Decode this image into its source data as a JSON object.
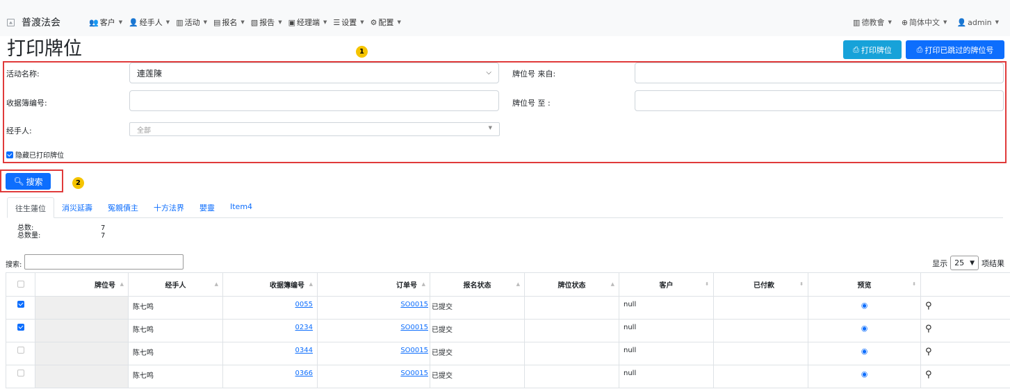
{
  "nav": {
    "brand": "普渡法会",
    "menu": [
      {
        "label": "客户",
        "icon": "users-icon"
      },
      {
        "label": "经手人",
        "icon": "user-icon"
      },
      {
        "label": "活动",
        "icon": "map-icon"
      },
      {
        "label": "报名",
        "icon": "clipboard-icon"
      },
      {
        "label": "报告",
        "icon": "file-icon"
      },
      {
        "label": "经理端",
        "icon": "briefcase-icon"
      },
      {
        "label": "设置",
        "icon": "sliders-icon"
      },
      {
        "label": "配置",
        "icon": "gear-icon"
      }
    ],
    "right": [
      {
        "label": "德教會",
        "icon": "building-icon"
      },
      {
        "label": "简体中文",
        "icon": "globe-icon"
      },
      {
        "label": "admin",
        "icon": "user-icon"
      }
    ]
  },
  "page": {
    "title": "打印牌位",
    "marker1": "1",
    "marker2": "2",
    "btn_print": "打印牌位",
    "btn_print_skipped": "打印已跳过的牌位号"
  },
  "filters": {
    "activity_label": "活动名称:",
    "activity_value": "連莲陳",
    "from_label": "牌位号 来自:",
    "from_value": "",
    "receipt_label": "收据簿编号:",
    "receipt_value": "",
    "to_label": "牌位号 至 :",
    "to_value": "",
    "handler_label": "经手人:",
    "handler_value": "全部",
    "hide_printed_label": "隐藏已打印牌位",
    "hide_printed_checked": true
  },
  "search_button": "搜索",
  "tabs": [
    "往生蓮位",
    "消災延壽",
    "冤親債主",
    "十方法界",
    "嬰靈",
    "Item4"
  ],
  "stats": {
    "total_label": "总数:",
    "total_value": "7",
    "qty_label": "总数量:",
    "qty_value": "7"
  },
  "table": {
    "search_label": "搜索:",
    "length_prefix": "显示",
    "length_value": "25",
    "length_suffix": "项结果",
    "columns": [
      "",
      "牌位号",
      "经手人",
      "收据簿编号",
      "订单号",
      "报名状态",
      "牌位状态",
      "客户",
      "已付款",
      "预览",
      ""
    ],
    "rows": [
      {
        "checked": true,
        "tablet_no": "",
        "handler": "陈七鸣",
        "receipt": "0055",
        "order": "SO0015",
        "reg_status": "已提交",
        "tablet_status": "",
        "customer": "null",
        "paid": ""
      },
      {
        "checked": true,
        "tablet_no": "",
        "handler": "陈七鸣",
        "receipt": "0234",
        "order": "SO0015",
        "reg_status": "已提交",
        "tablet_status": "",
        "customer": "null",
        "paid": ""
      },
      {
        "checked": false,
        "tablet_no": "",
        "handler": "陈七鸣",
        "receipt": "0344",
        "order": "SO0015",
        "reg_status": "已提交",
        "tablet_status": "",
        "customer": "null",
        "paid": ""
      },
      {
        "checked": false,
        "tablet_no": "",
        "handler": "陈七鸣",
        "receipt": "0366",
        "order": "SO0015",
        "reg_status": "已提交",
        "tablet_status": "",
        "customer": "null",
        "paid": ""
      }
    ]
  },
  "colors": {
    "primary": "#0d6efd",
    "info": "#17a2d9",
    "highlight": "#e03a3a",
    "marker": "#f5c400"
  }
}
